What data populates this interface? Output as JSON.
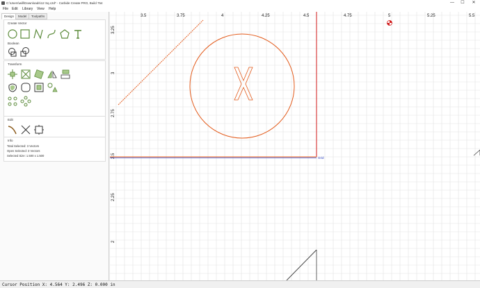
{
  "window": {
    "title": "C:\\Users\\will\\Downloads\\12 Sq.c2d* - Carbide Create PRO, Build 754",
    "minimize": "—",
    "maximize": "☐",
    "close": "✕"
  },
  "menu": {
    "items": [
      "File",
      "Edit",
      "Library",
      "View",
      "Help"
    ]
  },
  "sidebar": {
    "tabs": [
      "Design",
      "Model",
      "Toolpaths"
    ],
    "create_vector_label": "Create Vector",
    "boolean_label": "Boolean",
    "transform_label": "Transform",
    "edit_label": "Edit",
    "info_label": "Info",
    "info": {
      "total_selected": "Total Selected:  3 Vectors",
      "open_selected": "Open Selected:  3 Vectors",
      "selected_size": "Selected Size:    1.500 x 1.500"
    }
  },
  "canvas": {
    "x_ticks": [
      "3.5",
      "3.75",
      "4",
      "4.25",
      "4.5",
      "4.75",
      "5",
      "5.25",
      "5.5"
    ],
    "y_ticks": [
      "3.25",
      "3",
      "2.75",
      "2.5",
      "2.25",
      "2"
    ],
    "grid_label": "Grid",
    "accent_color": "#e35a1a",
    "axis_color": "#d11a1a"
  },
  "status": {
    "cursor": "Cursor Position X: 4.564 Y: 2.496 Z: 0.000 in"
  }
}
